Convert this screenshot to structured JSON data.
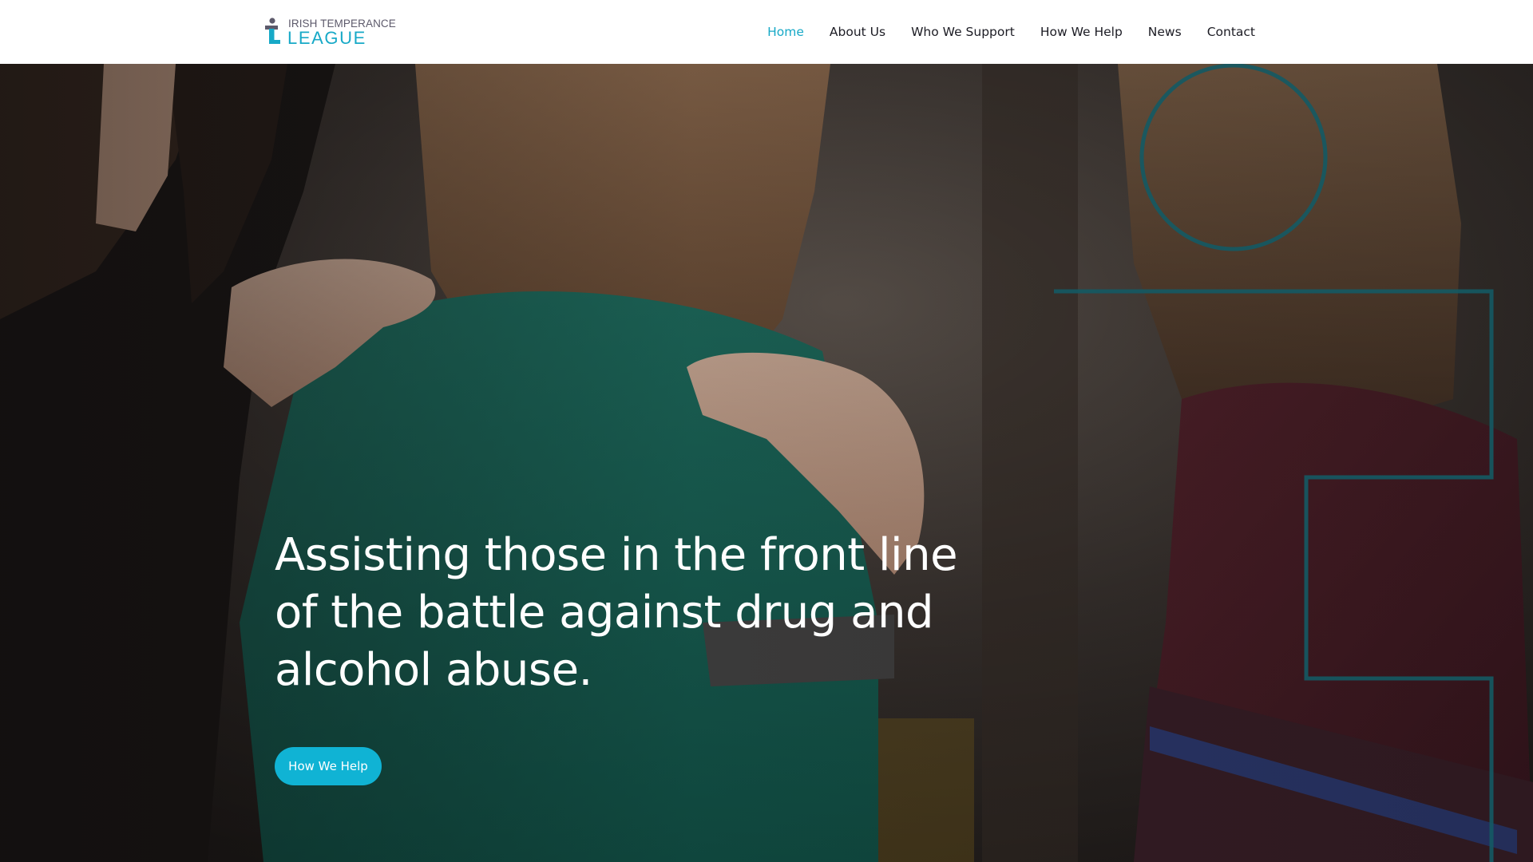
{
  "brand": {
    "name_line1": "IRISH TEMPERANCE",
    "name_line2": "LEAGUE",
    "colors": {
      "accent": "#17a9c7",
      "mark_dark": "#5d5a6b",
      "button": "#10b3d4"
    },
    "icon": "person-logo-icon"
  },
  "nav": {
    "items": [
      {
        "label": "Home",
        "active": true
      },
      {
        "label": "About Us",
        "active": false
      },
      {
        "label": "Who We Support",
        "active": false
      },
      {
        "label": "How We Help",
        "active": false
      },
      {
        "label": "News",
        "active": false
      },
      {
        "label": "Contact",
        "active": false
      }
    ]
  },
  "hero": {
    "heading": "Assisting those in the front line of the battle against drug and alcohol abuse.",
    "cta_label": "How We Help",
    "image_description_icon": "support-group-photo"
  }
}
